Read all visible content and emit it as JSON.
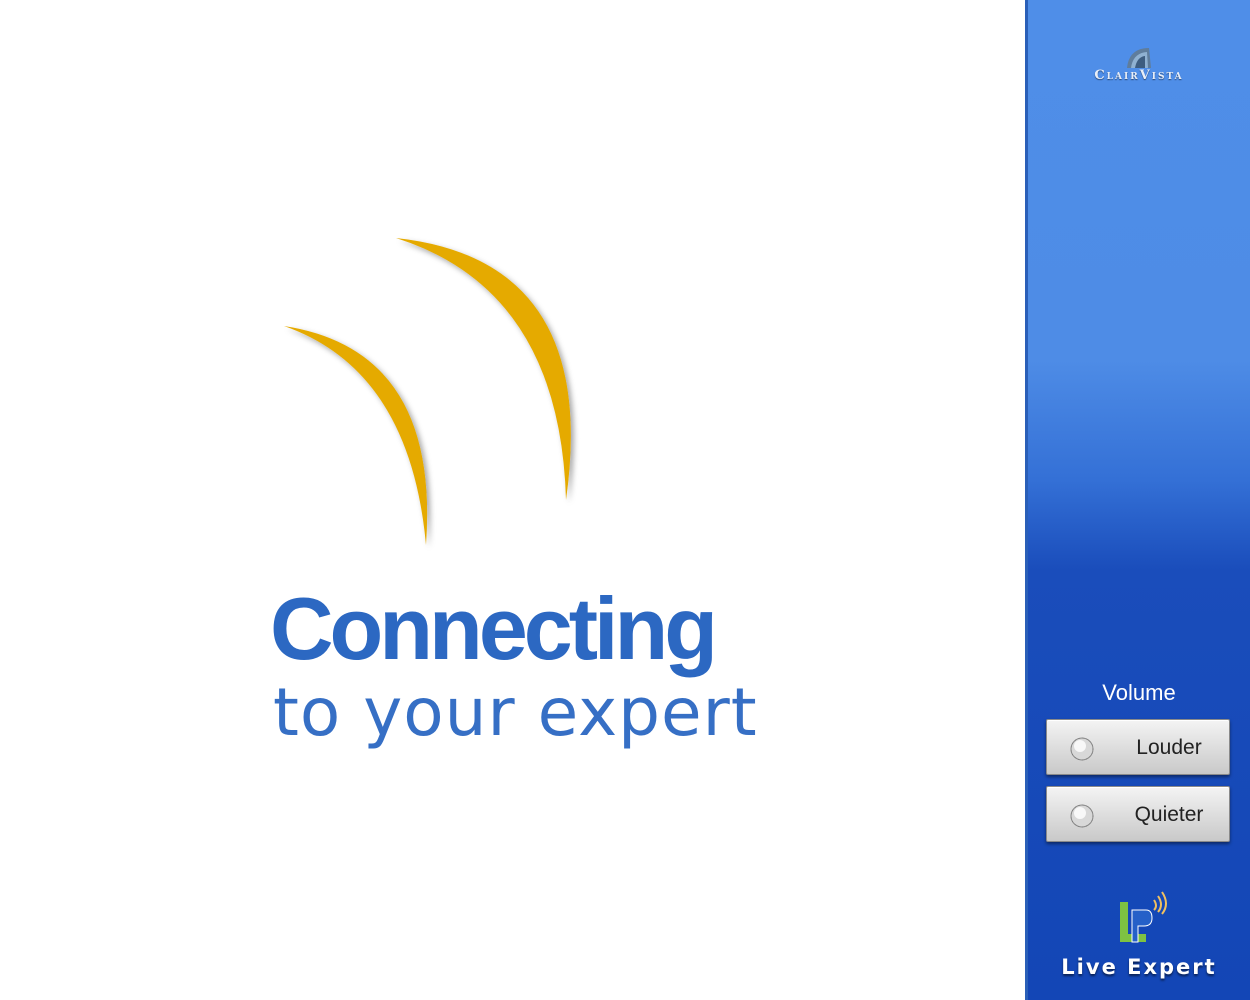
{
  "main": {
    "title": "Connecting",
    "subtitle": "to your expert"
  },
  "sidebar": {
    "brand": "ClairVista",
    "volume_label": "Volume",
    "louder_label": "Louder",
    "quieter_label": "Quieter",
    "product_name": "Live Expert"
  },
  "colors": {
    "accent_blue": "#2c68c2",
    "arc_gold": "#e5aa00",
    "sidebar_blue": "#1346b6"
  },
  "icons": {
    "arcs": "signal-arcs-icon",
    "brand": "clairvista-logo-icon",
    "knob": "volume-knob-icon",
    "product": "live-expert-logo-icon"
  }
}
